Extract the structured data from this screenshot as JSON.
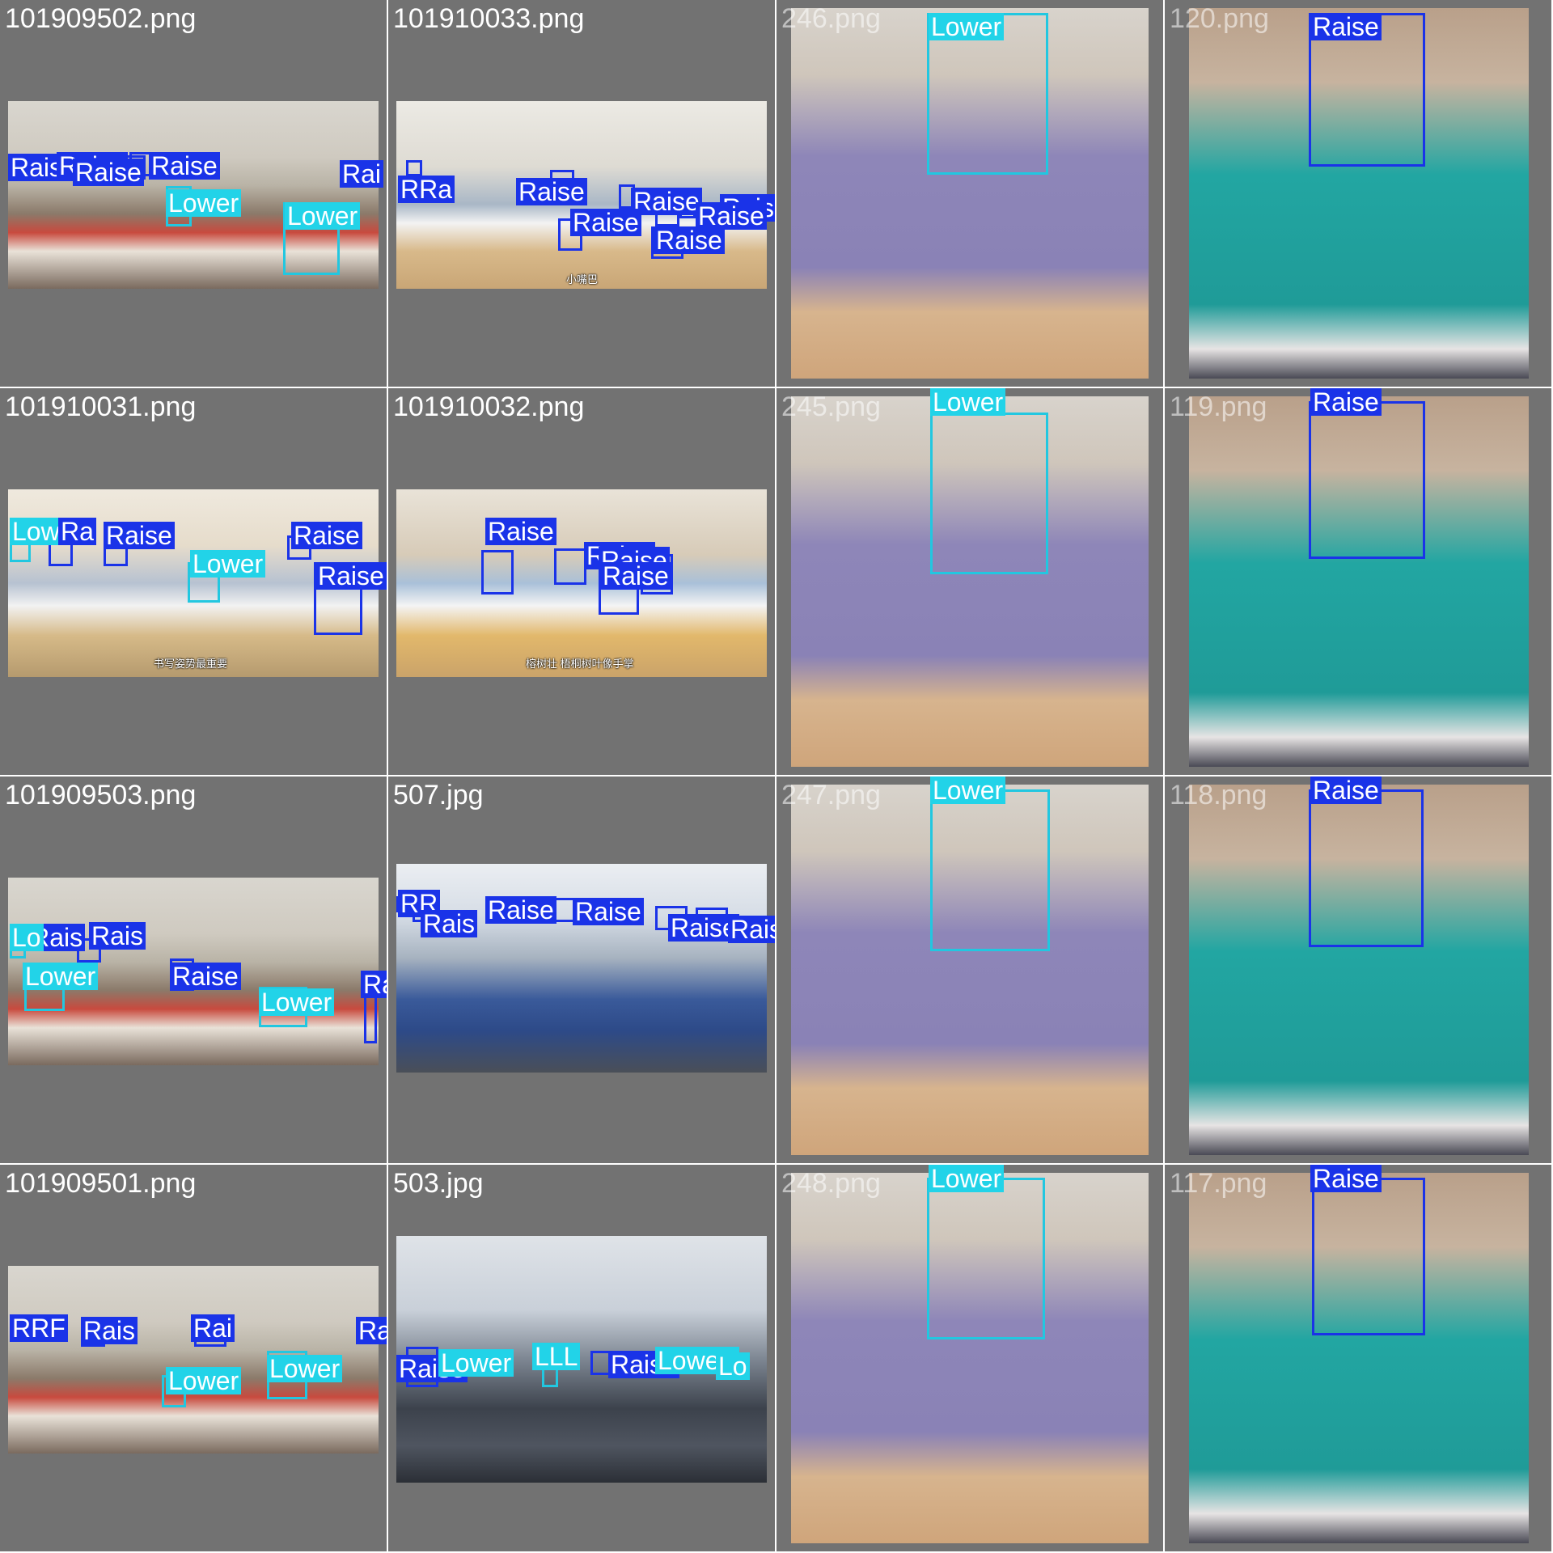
{
  "tiles": [
    {
      "filename": "101909502.png",
      "scene": "classroom-a",
      "detections": [
        {
          "cls": "Raise",
          "label": "Raise"
        },
        {
          "cls": "Raise",
          "label": "Raise"
        },
        {
          "cls": "Raise",
          "label": "Raise"
        },
        {
          "cls": "Raise",
          "label": "Raise"
        },
        {
          "cls": "Lower",
          "label": "Lower"
        },
        {
          "cls": "Lower",
          "label": "Lower"
        },
        {
          "cls": "Raise",
          "label": "Rai"
        }
      ]
    },
    {
      "filename": "101910033.png",
      "scene": "classroom-b",
      "subtitle": "小嘴巴",
      "detections": [
        {
          "cls": "Raise",
          "label": "RRa"
        },
        {
          "cls": "Raise",
          "label": "Raise"
        },
        {
          "cls": "Raise",
          "label": "Raise"
        },
        {
          "cls": "Raise",
          "label": "Raise"
        },
        {
          "cls": "Raise",
          "label": "Raise"
        },
        {
          "cls": "Raise",
          "label": "Raise"
        },
        {
          "cls": "Raise",
          "label": "Raise"
        }
      ]
    },
    {
      "filename": "246.png",
      "scene": "girl",
      "detections": [
        {
          "cls": "Lower",
          "label": "Lower"
        }
      ]
    },
    {
      "filename": "120.png",
      "scene": "boy",
      "detections": [
        {
          "cls": "Raise",
          "label": "Raise"
        }
      ]
    },
    {
      "filename": "101910031.png",
      "scene": "classroom-c",
      "subtitle": "书写姿势最重要",
      "detections": [
        {
          "cls": "Lower",
          "label": "Low"
        },
        {
          "cls": "Raise",
          "label": "Ra"
        },
        {
          "cls": "Raise",
          "label": "Raise"
        },
        {
          "cls": "Lower",
          "label": "Lower"
        },
        {
          "cls": "Raise",
          "label": "Raise"
        },
        {
          "cls": "Raise",
          "label": "Raise"
        }
      ]
    },
    {
      "filename": "101910032.png",
      "scene": "classroom-d",
      "subtitle": "榕树壮 梧桐树叶像手掌",
      "detections": [
        {
          "cls": "Raise",
          "label": "Raise"
        },
        {
          "cls": "Raise",
          "label": "Raise"
        },
        {
          "cls": "Raise",
          "label": "Raise"
        },
        {
          "cls": "Raise",
          "label": "Raise"
        }
      ]
    },
    {
      "filename": "245.png",
      "scene": "girl",
      "detections": [
        {
          "cls": "Lower",
          "label": "Lower"
        }
      ]
    },
    {
      "filename": "119.png",
      "scene": "boy",
      "detections": [
        {
          "cls": "Raise",
          "label": "Raise"
        }
      ]
    },
    {
      "filename": "101909503.png",
      "scene": "classroom-a",
      "detections": [
        {
          "cls": "Raise",
          "label": "RRais"
        },
        {
          "cls": "Raise",
          "label": "Rais"
        },
        {
          "cls": "Lower",
          "label": "Lower"
        },
        {
          "cls": "Raise",
          "label": "Raise"
        },
        {
          "cls": "Lower",
          "label": "Lower"
        },
        {
          "cls": "Raise",
          "label": "Raise"
        },
        {
          "cls": "Lower",
          "label": "Lo"
        }
      ]
    },
    {
      "filename": "507.jpg",
      "scene": "lecture-hall",
      "detections": [
        {
          "cls": "Raise",
          "label": "RR"
        },
        {
          "cls": "Raise",
          "label": "Rais"
        },
        {
          "cls": "Raise",
          "label": "Raise"
        },
        {
          "cls": "Raise",
          "label": "Raise"
        },
        {
          "cls": "Raise",
          "label": "Raise"
        },
        {
          "cls": "Raise",
          "label": "Raise"
        }
      ]
    },
    {
      "filename": "247.png",
      "scene": "girl",
      "detections": [
        {
          "cls": "Lower",
          "label": "Lower"
        }
      ]
    },
    {
      "filename": "118.png",
      "scene": "boy",
      "detections": [
        {
          "cls": "Raise",
          "label": "Raise"
        }
      ]
    },
    {
      "filename": "101909501.png",
      "scene": "classroom-a",
      "detections": [
        {
          "cls": "Raise",
          "label": "RRF"
        },
        {
          "cls": "Raise",
          "label": "Rais"
        },
        {
          "cls": "Raise",
          "label": "Rai"
        },
        {
          "cls": "Lower",
          "label": "Lower"
        },
        {
          "cls": "Lower",
          "label": "Lower"
        },
        {
          "cls": "Raise",
          "label": "Rai"
        }
      ]
    },
    {
      "filename": "503.jpg",
      "scene": "computer-room",
      "detections": [
        {
          "cls": "Raise",
          "label": "Raise"
        },
        {
          "cls": "Lower",
          "label": "Lower"
        },
        {
          "cls": "Lower",
          "label": "LLL"
        },
        {
          "cls": "Raise",
          "label": "Raise"
        },
        {
          "cls": "Lower",
          "label": "Lowerr"
        },
        {
          "cls": "Lower",
          "label": "Lo"
        }
      ]
    },
    {
      "filename": "248.png",
      "scene": "girl",
      "detections": [
        {
          "cls": "Lower",
          "label": "Lower"
        }
      ]
    },
    {
      "filename": "117.png",
      "scene": "boy",
      "detections": [
        {
          "cls": "Raise",
          "label": "Raise"
        }
      ]
    }
  ],
  "colors": {
    "tile_bg": "#727272",
    "raise": "#1a33e8",
    "lower": "#22d3e8"
  }
}
